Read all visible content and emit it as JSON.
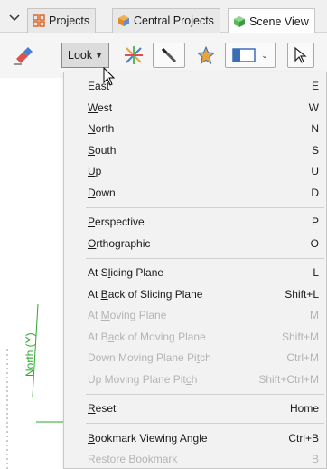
{
  "tabs": [
    {
      "label": "Projects",
      "icon": "projects-grid-icon",
      "active": false
    },
    {
      "label": "Central Projects",
      "icon": "central-projects-icon",
      "active": false
    },
    {
      "label": "Scene View",
      "icon": "scene-cube-icon",
      "active": true
    }
  ],
  "toolbar": {
    "look_label": "Look",
    "buttons": [
      "eraser-icon",
      "look-dropdown",
      "axes-icon",
      "pencil-icon",
      "star-icon",
      "split-view-icon",
      "pointer-icon"
    ]
  },
  "scene": {
    "axis_label": "North (Y)"
  },
  "menu": {
    "groups": [
      [
        {
          "label": "East",
          "mnemonic": "E",
          "shortcut": "E",
          "enabled": true
        },
        {
          "label": "West",
          "mnemonic": "W",
          "shortcut": "W",
          "enabled": true
        },
        {
          "label": "North",
          "mnemonic": "N",
          "shortcut": "N",
          "enabled": true
        },
        {
          "label": "South",
          "mnemonic": "S",
          "shortcut": "S",
          "enabled": true
        },
        {
          "label": "Up",
          "mnemonic": "U",
          "shortcut": "U",
          "enabled": true
        },
        {
          "label": "Down",
          "mnemonic": "D",
          "shortcut": "D",
          "enabled": true
        }
      ],
      [
        {
          "label": "Perspective",
          "mnemonic": "P",
          "shortcut": "P",
          "enabled": true
        },
        {
          "label": "Orthographic",
          "mnemonic": "O",
          "shortcut": "O",
          "enabled": true
        }
      ],
      [
        {
          "label": "At Slicing Plane",
          "mnemonic": "l",
          "shortcut": "L",
          "enabled": true
        },
        {
          "label": "At Back of Slicing Plane",
          "mnemonic": "B",
          "shortcut": "Shift+L",
          "enabled": true
        },
        {
          "label": "At Moving Plane",
          "mnemonic": "M",
          "shortcut": "M",
          "enabled": false
        },
        {
          "label": "At Back of Moving Plane",
          "mnemonic": "a",
          "shortcut": "Shift+M",
          "enabled": false
        },
        {
          "label": "Down Moving Plane Pitch",
          "mnemonic": "t",
          "shortcut": "Ctrl+M",
          "enabled": false
        },
        {
          "label": "Up Moving Plane Pitch",
          "mnemonic": "c",
          "shortcut": "Shift+Ctrl+M",
          "enabled": false
        }
      ],
      [
        {
          "label": "Reset",
          "mnemonic": "R",
          "shortcut": "Home",
          "enabled": true
        }
      ],
      [
        {
          "label": "Bookmark Viewing Angle",
          "mnemonic": "B",
          "shortcut": "Ctrl+B",
          "enabled": true
        },
        {
          "label": "Restore Bookmark",
          "mnemonic": "R",
          "shortcut": "B",
          "enabled": false
        }
      ]
    ]
  },
  "colors": {
    "accent_green": "#2ba82b",
    "disabled_text": "#b4b4b4",
    "projects_icon": "#e0672a",
    "scene_icon": "#5cb85c"
  }
}
